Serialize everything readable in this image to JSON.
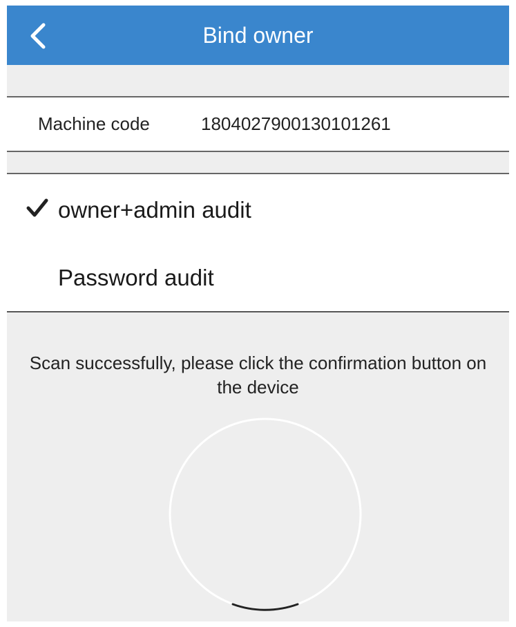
{
  "header": {
    "title": "Bind owner",
    "back_icon": "chevron-left-icon",
    "color": "#3a86cd"
  },
  "machine": {
    "label": "Machine code",
    "value": "1804027900130101261"
  },
  "audit_options": [
    {
      "label": "owner+admin audit",
      "selected": true,
      "icon": "checkmark-icon"
    },
    {
      "label": "Password audit",
      "selected": false
    }
  ],
  "status": {
    "message": "Scan successfully, please click the confirmation button on the device",
    "spinner_icon": "loading-ring-icon"
  }
}
